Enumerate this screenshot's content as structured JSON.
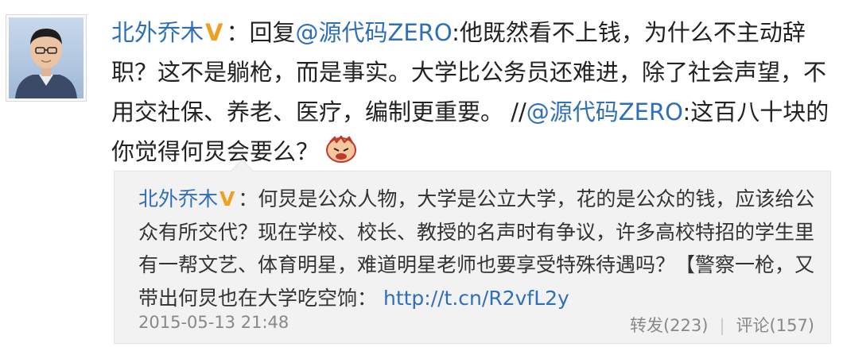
{
  "post": {
    "author": "北外乔木",
    "reply_prefix": "：回复",
    "mention1": "@源代码ZERO",
    "text1": ":他既然看不上钱，为什么不主动辞职？这不是躺枪，而是事实。大学比公务员还难进，除了社会声望，不用交社保、养老、医疗，编制更重要。",
    "repost_sep": "//",
    "mention2": "@源代码ZERO",
    "text2": ":这百八十块的你觉得何炅会要么？",
    "emoji": "angry-face-emoji"
  },
  "quoted": {
    "author": "北外乔木",
    "text": "：何炅是公众人物，大学是公立大学，花的是公众的钱，应该给公众有所交代？现在学校、校长、教授的名声时有争议，许多高校特招的学生里有一帮文艺、体育明星，难道明星老师也要享受特殊待遇吗？【警察一枪，又带出何炅也在大学吃空饷：",
    "link": "http://t.cn/R2vfL2y",
    "timestamp": "2015-05-13 21:48",
    "repost": "转发(223)",
    "comment": "评论(157)"
  },
  "icons": {
    "verified": "V",
    "verified_color": "#f0a020",
    "link_color": "#2f6fb7"
  }
}
